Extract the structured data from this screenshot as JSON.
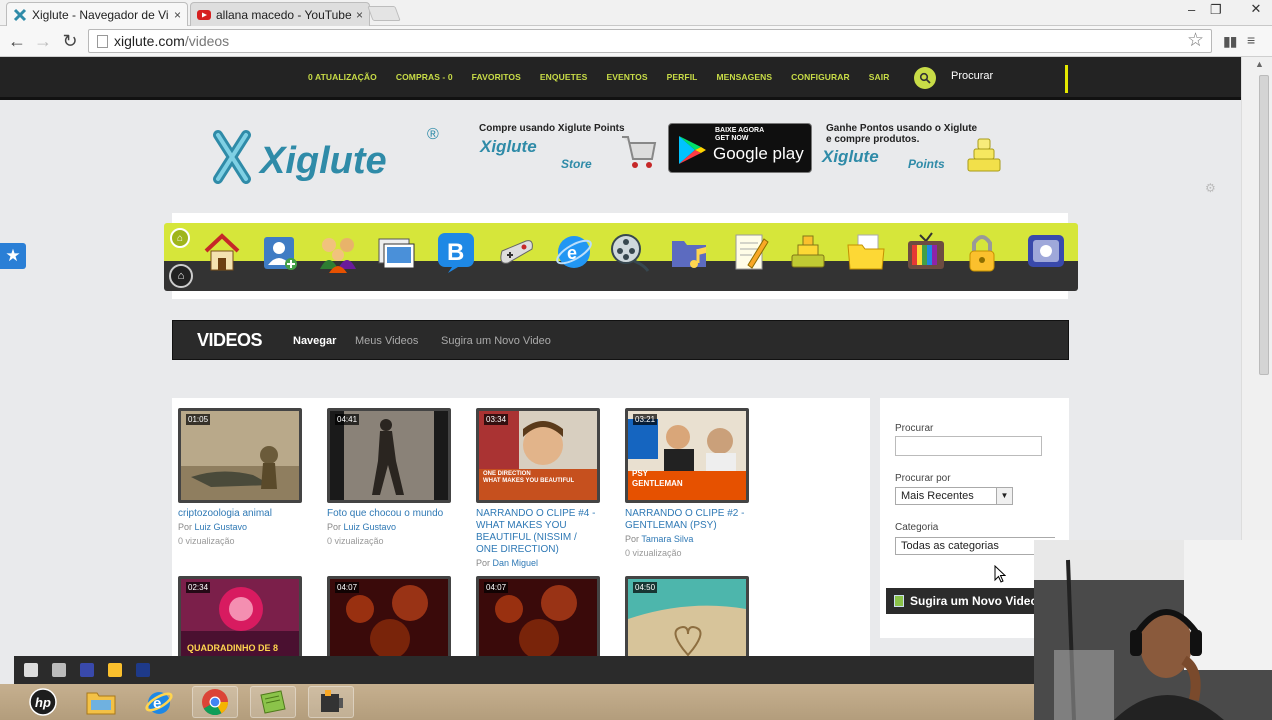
{
  "browser": {
    "tabs": [
      {
        "title": "Xiglute - Navegador de Vi",
        "close": "×",
        "active": true
      },
      {
        "title": "allana macedo - YouTube",
        "close": "×",
        "active": false
      }
    ],
    "window_controls": {
      "minimize": "‒",
      "restore": "❐",
      "close": "✕"
    },
    "url_host": "xiglute.com",
    "url_path": "/videos"
  },
  "site": {
    "nav": [
      "0 ATUALIZAÇÃO",
      "COMPRAS - 0",
      "FAVORITOS",
      "ENQUETES",
      "EVENTOS",
      "PERFIL",
      "MENSAGENS",
      "CONFIGURAR",
      "SAIR"
    ],
    "search_label": "Procurar",
    "logo_text": "Xiglute",
    "logo_reg": "®",
    "promo_left": "Compre usando Xiglute Points",
    "store_logo": "Xiglute",
    "store_sub": "Store",
    "gplay_get": "BAIXE AGORA\nGET NOW",
    "gplay_name": "Google play",
    "promo_right_1": "Ganhe Pontos usando o Xiglute",
    "promo_right_2": "e compre produtos.",
    "points_logo": "Xiglute",
    "points_sub": "Points"
  },
  "iconbar": {
    "icons": [
      "home-icon",
      "add-contact-icon",
      "friends-icon",
      "photos-icon",
      "blog-icon",
      "games-icon",
      "browser-icon",
      "videos-icon",
      "music-icon",
      "notes-icon",
      "shop-icon",
      "files-icon",
      "tv-icon",
      "lock-icon",
      "messenger-icon"
    ]
  },
  "videos": {
    "title": "VIDEOS",
    "tabs": [
      "Navegar",
      "Meus Videos",
      "Sugira um Novo Video"
    ],
    "items": [
      {
        "duration": "01:05",
        "title": "criptozoologia animal",
        "by": "Por",
        "user": "Luiz Gustavo",
        "views": "0 vizualização"
      },
      {
        "duration": "04:41",
        "title": "Foto que chocou o mundo",
        "by": "Por",
        "user": "Luiz Gustavo",
        "views": "0 vizualização"
      },
      {
        "duration": "03:34",
        "title": "NARRANDO O CLIPE #4 - WHAT MAKES YOU BEAUTIFUL (NISSIM / ONE DIRECTION)",
        "by": "Por",
        "user": "Dan Miguel",
        "views": ""
      },
      {
        "duration": "03:21",
        "title": "NARRANDO O CLIPE #2 - GENTLEMAN (PSY)",
        "by": "Por",
        "user": "Tamara Silva",
        "views": "0 vizualização"
      },
      {
        "duration": "02:34",
        "title": "",
        "by": "",
        "user": "",
        "views": ""
      },
      {
        "duration": "04:07",
        "title": "",
        "by": "",
        "user": "",
        "views": ""
      },
      {
        "duration": "04:07",
        "title": "",
        "by": "",
        "user": "",
        "views": ""
      },
      {
        "duration": "04:50",
        "title": "",
        "by": "",
        "user": "",
        "views": ""
      }
    ],
    "thumb_captions": {
      "one_direction": "ONE DIRECTION\nWHAT MAKES YOU BEAUTIFUL",
      "psy": "PSY\nGENTLEMAN",
      "quadradinho": "QUADRADINHO DE 8"
    }
  },
  "sidebar": {
    "search_label": "Procurar",
    "sort_label": "Procurar por",
    "sort_value": "Mais Recentes",
    "category_label": "Categoria",
    "category_value": "Todas as categorias",
    "suggest_button": "Sugira um Novo Video"
  },
  "taskbar": {
    "items": [
      "hp-icon",
      "file-explorer-icon",
      "internet-explorer-icon",
      "chrome-icon",
      "app-icon",
      "camera-app-icon"
    ]
  },
  "colors": {
    "accent": "#c8dc47",
    "header_bg": "#232323",
    "link": "#2f79b5",
    "brand_blue": "#2f8ba8"
  }
}
